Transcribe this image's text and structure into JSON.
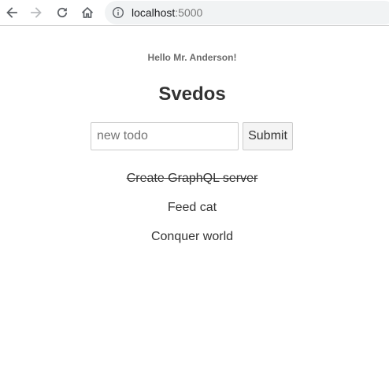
{
  "browser": {
    "url_host": "localhost",
    "url_port": ":5000"
  },
  "page": {
    "greeting": "Hello Mr. Anderson!",
    "title": "Svedos"
  },
  "form": {
    "input_value": "",
    "input_placeholder": "new todo",
    "submit_label": "Submit"
  },
  "todos": [
    {
      "text": "Create GraphQL server",
      "done": true
    },
    {
      "text": "Feed cat",
      "done": false
    },
    {
      "text": "Conquer world",
      "done": false
    }
  ],
  "colors": {
    "text": "#333333",
    "greeting": "#6b6b6b",
    "omnibox_bg": "#f1f3f4",
    "button_bg": "#f4f4f4",
    "border": "#cccccc"
  },
  "icons": {
    "back": "arrow-left",
    "forward": "arrow-right",
    "reload": "reload",
    "home": "home",
    "site_info": "info-circle"
  }
}
